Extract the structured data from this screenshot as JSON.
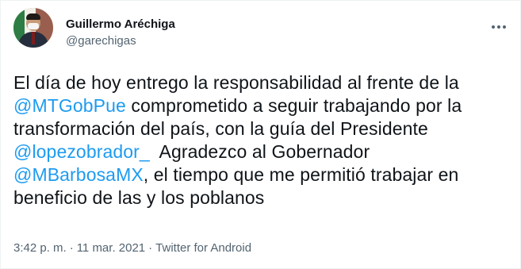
{
  "author": {
    "display_name": "Guillermo Aréchiga",
    "handle": "@garechigas"
  },
  "tweet": {
    "line1": "El día de hoy entrego la responsabilidad al frente de la",
    "mention1": "@MTGobPue",
    "line2_rest": " comprometido a seguir trabajando por la",
    "line3": "transformación del país, con la guía del Presidente",
    "mention2": "@lopezobrador_",
    "line4_rest": "  Agradezco al Gobernador",
    "mention3": "@MBarbosaMX",
    "line5_rest": ", el tiempo que me permitió trabajar en",
    "line6": "beneficio de las y los poblanos"
  },
  "meta": {
    "time": "3:42 p. m.",
    "separator": "·",
    "date": "11 mar. 2021",
    "source": "Twitter for Android"
  },
  "colors": {
    "mention": "#1d9bf0",
    "secondary_text": "#536471",
    "primary_text": "#0f1419"
  },
  "icons": {
    "more": "more-options-icon"
  }
}
